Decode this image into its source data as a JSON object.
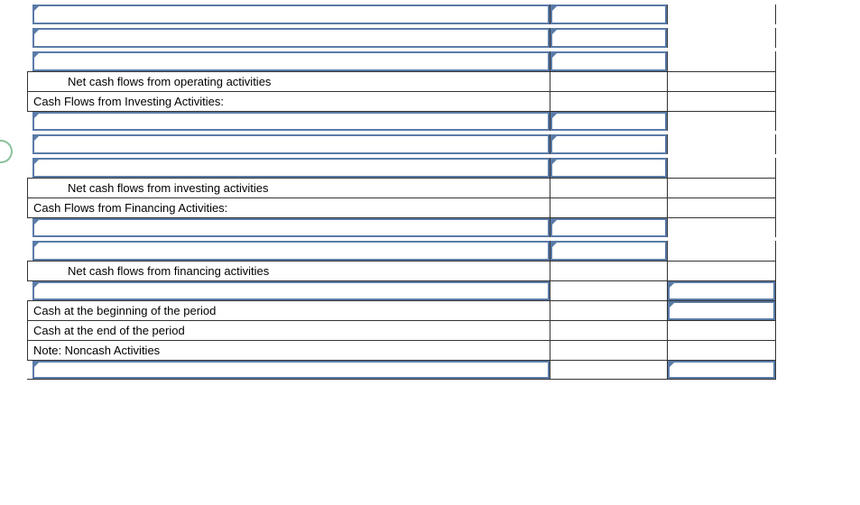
{
  "rows": {
    "op_subtotal": "Net cash flows from operating activities",
    "inv_header": "Cash Flows from Investing Activities:",
    "inv_subtotal": "Net cash flows from investing activities",
    "fin_header": "Cash Flows from Financing Activities:",
    "fin_subtotal": "Net cash flows from financing activities",
    "cash_begin": "Cash at the beginning of the period",
    "cash_end": "Cash at the end of the period",
    "noncash": "Note: Noncash Activities"
  }
}
